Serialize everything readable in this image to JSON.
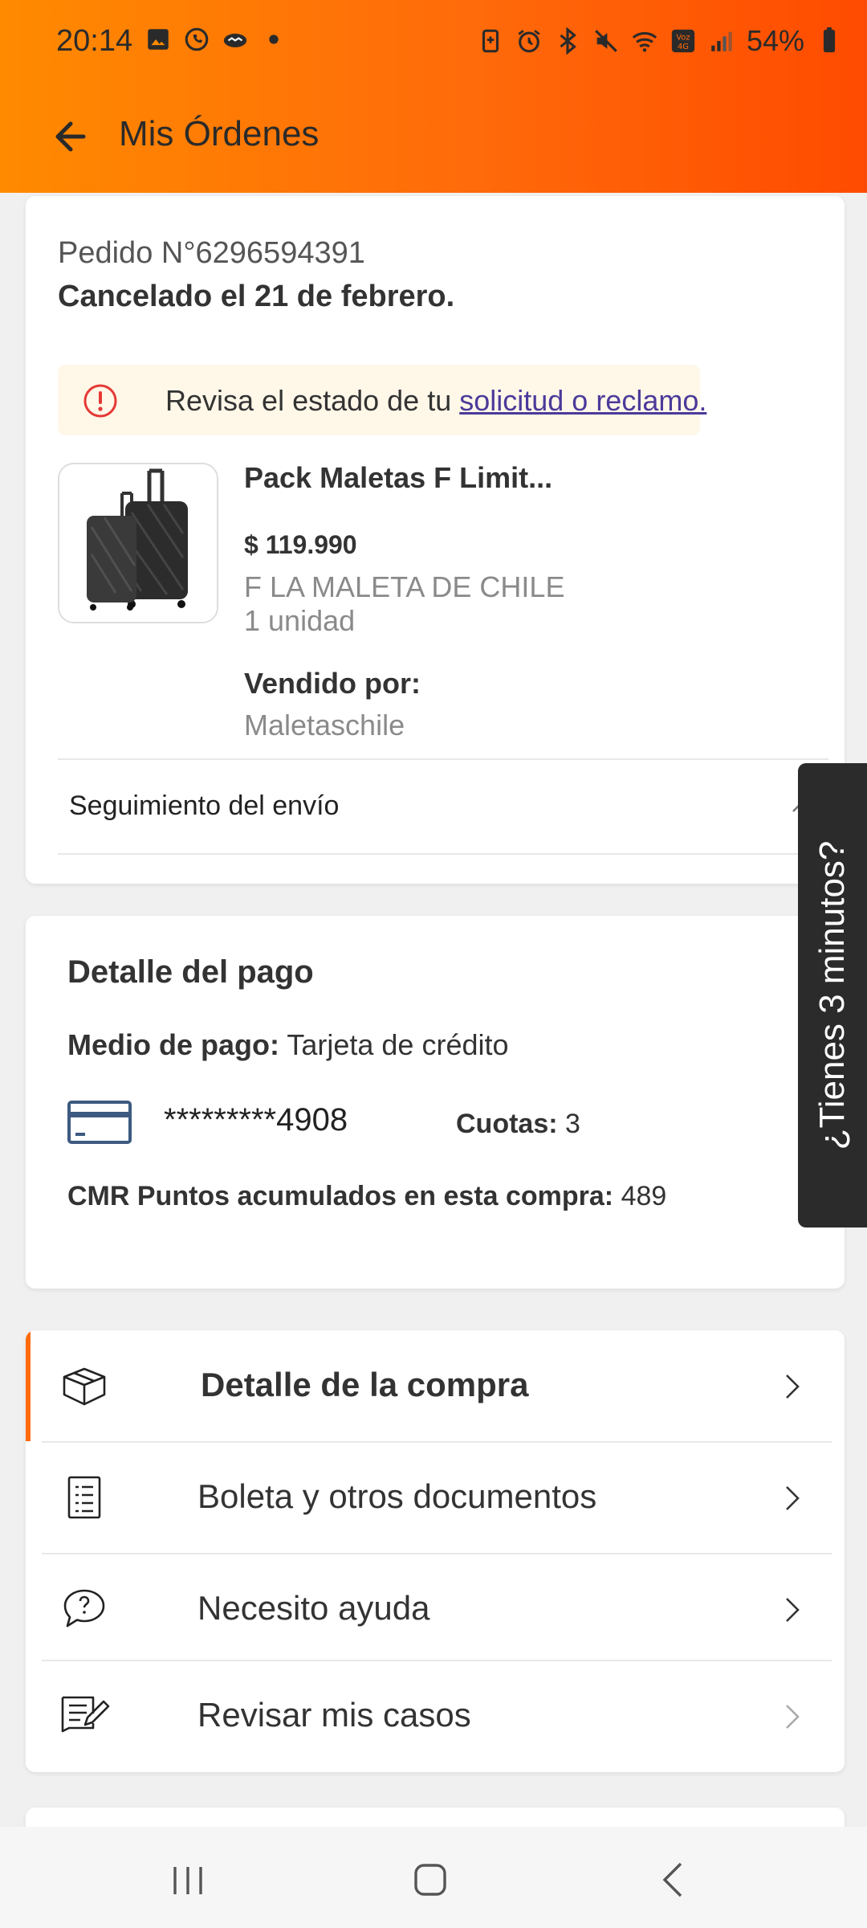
{
  "status_bar": {
    "time": "20:14",
    "battery": "54%"
  },
  "app_bar": {
    "title": "Mis Órdenes"
  },
  "order": {
    "number": "Pedido N°6296594391",
    "status": "Cancelado el 21 de febrero.",
    "alert_text": "Revisa el estado de tu ",
    "alert_link": "solicitud o reclamo.",
    "product": {
      "name": "Pack Maletas F Limit...",
      "price": "$ 119.990",
      "brand": "F LA MALETA DE CHILE",
      "quantity": "1 unidad",
      "sold_by_label": "Vendido por:",
      "seller": "Maletaschile"
    },
    "tracking_label": "Seguimiento del envío"
  },
  "payment": {
    "title": "Detalle del pago",
    "method_label": "Medio de pago:",
    "method_value": " Tarjeta de crédito",
    "card_number": "*********4908",
    "installments_label": "Cuotas:",
    "installments_value": " 3",
    "points_label": "CMR Puntos acumulados en esta compra:",
    "points_value": " 489"
  },
  "menu": [
    {
      "label": "Detalle de la compra",
      "icon": "package-icon"
    },
    {
      "label": "Boleta y otros documentos",
      "icon": "document-list-icon"
    },
    {
      "label": "Necesito ayuda",
      "icon": "help-chat-icon"
    },
    {
      "label": "Revisar mis casos",
      "icon": "edit-notes-icon"
    }
  ],
  "side_tab": {
    "label": "¿Tienes 3 minutos?"
  },
  "colors": {
    "accent": "#ff6a0a",
    "alert_bg": "#fff7e8",
    "link": "#4b3a9a",
    "error_icon": "#e53935"
  }
}
